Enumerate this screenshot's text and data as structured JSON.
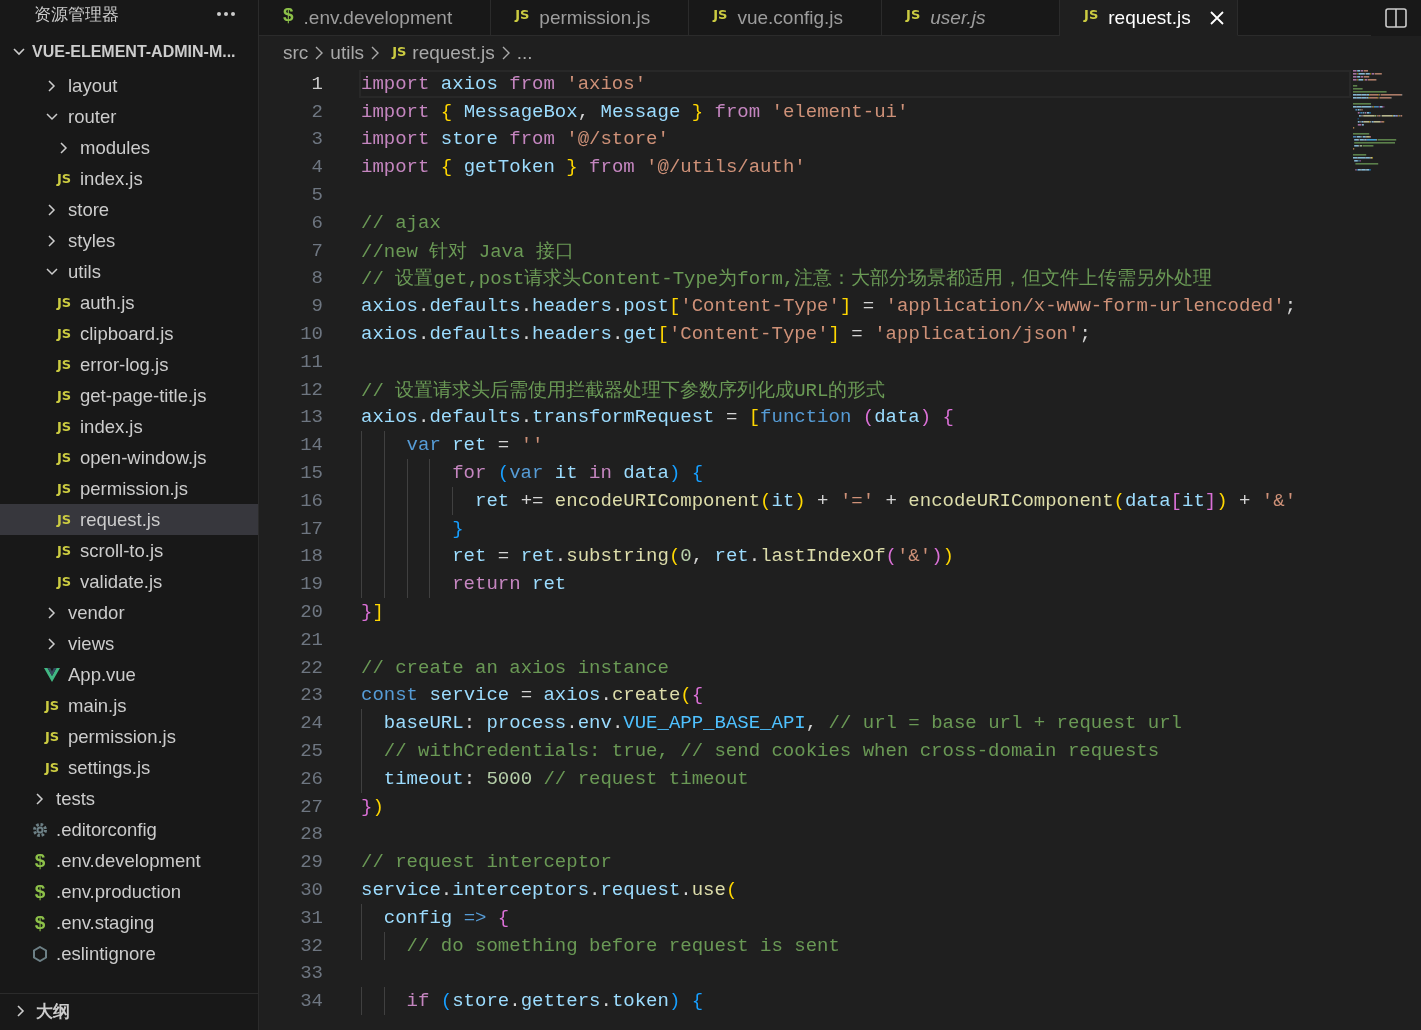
{
  "explorer": {
    "title": "资源管理器",
    "root": {
      "label": "VUE-ELEMENT-ADMIN-M...",
      "expanded": true,
      "children": [
        {
          "children": [
            {
              "label": "layout",
              "expanded": false
            },
            {
              "label": "router",
              "expanded": true,
              "children": [
                {
                  "label": "modules",
                  "expanded": false
                },
                {
                  "label": "index.js",
                  "icon": {
                    "kind": "js",
                    "text": "JS"
                  },
                  "selected": false
                }
              ]
            },
            {
              "label": "store",
              "expanded": false
            },
            {
              "label": "styles",
              "expanded": false
            },
            {
              "label": "utils",
              "expanded": true,
              "children": [
                {
                  "label": "auth.js",
                  "icon": {
                    "kind": "js",
                    "text": "JS"
                  },
                  "selected": false
                },
                {
                  "label": "clipboard.js",
                  "icon": {
                    "kind": "js",
                    "text": "JS"
                  },
                  "selected": false
                },
                {
                  "label": "error-log.js",
                  "icon": {
                    "kind": "js",
                    "text": "JS"
                  },
                  "selected": false
                },
                {
                  "label": "get-page-title.js",
                  "icon": {
                    "kind": "js",
                    "text": "JS"
                  },
                  "selected": false
                },
                {
                  "label": "index.js",
                  "icon": {
                    "kind": "js",
                    "text": "JS"
                  },
                  "selected": false
                },
                {
                  "label": "open-window.js",
                  "icon": {
                    "kind": "js",
                    "text": "JS"
                  },
                  "selected": false
                },
                {
                  "label": "permission.js",
                  "icon": {
                    "kind": "js",
                    "text": "JS"
                  },
                  "selected": false
                },
                {
                  "label": "request.js",
                  "icon": {
                    "kind": "js",
                    "text": "JS"
                  },
                  "selected": true
                },
                {
                  "label": "scroll-to.js",
                  "icon": {
                    "kind": "js",
                    "text": "JS"
                  },
                  "selected": false
                },
                {
                  "label": "validate.js",
                  "icon": {
                    "kind": "js",
                    "text": "JS"
                  },
                  "selected": false
                }
              ]
            },
            {
              "label": "vendor",
              "expanded": false
            },
            {
              "label": "views",
              "expanded": false
            },
            {
              "label": "App.vue",
              "icon": {
                "kind": "vue"
              },
              "selected": false
            },
            {
              "label": "main.js",
              "icon": {
                "kind": "js",
                "text": "JS"
              },
              "selected": false
            },
            {
              "label": "permission.js",
              "icon": {
                "kind": "js",
                "text": "JS"
              },
              "selected": false
            },
            {
              "label": "settings.js",
              "icon": {
                "kind": "js",
                "text": "JS"
              },
              "selected": false
            }
          ]
        },
        {
          "label": "tests",
          "expanded": false
        },
        {
          "label": ".editorconfig",
          "icon": {
            "kind": "gear"
          },
          "selected": false
        },
        {
          "label": ".env.development",
          "icon": {
            "kind": "env",
            "text": "$"
          },
          "selected": false
        },
        {
          "label": ".env.production",
          "icon": {
            "kind": "env",
            "text": "$"
          },
          "selected": false
        },
        {
          "label": ".env.staging",
          "icon": {
            "kind": "env",
            "text": "$"
          },
          "selected": false
        },
        {
          "label": ".eslintignore",
          "icon": {
            "kind": "eslint"
          },
          "selected": false
        }
      ]
    }
  },
  "outline": {
    "label": "大纲",
    "expanded": false
  },
  "tabs": [
    {
      "label": ".env.development",
      "icon": {
        "kind": "env",
        "text": "$"
      },
      "selected": false,
      "preview": false
    },
    {
      "label": "permission.js",
      "icon": {
        "kind": "js",
        "text": "JS"
      },
      "selected": false,
      "preview": false
    },
    {
      "label": "vue.config.js",
      "icon": {
        "kind": "js",
        "text": "JS"
      },
      "selected": false,
      "preview": false
    },
    {
      "label": "user.js",
      "icon": {
        "kind": "js",
        "text": "JS"
      },
      "selected": false,
      "preview": true
    },
    {
      "label": "request.js",
      "icon": {
        "kind": "js",
        "text": "JS"
      },
      "selected": true,
      "preview": false
    }
  ],
  "breadcrumb": {
    "items": [
      {
        "label": "src"
      },
      {
        "label": "utils"
      },
      {
        "label": "request.js",
        "icon": {
          "kind": "js",
          "text": "JS"
        }
      }
    ],
    "more": "..."
  },
  "code": {
    "lines": [
      {
        "number": "1",
        "current": true,
        "tokens": [
          {
            "kind": "k",
            "text": "import "
          },
          {
            "kind": "v",
            "text": "axios "
          },
          {
            "kind": "k",
            "text": "from "
          },
          {
            "kind": "t",
            "text": "'axios'"
          }
        ]
      },
      {
        "number": "2",
        "current": false,
        "tokens": [
          {
            "kind": "k",
            "text": "import "
          },
          {
            "kind": "b1",
            "text": "{ "
          },
          {
            "kind": "v",
            "text": "MessageBox"
          },
          {
            "kind": "p",
            "text": ", "
          },
          {
            "kind": "v",
            "text": "Message "
          },
          {
            "kind": "b1",
            "text": "} "
          },
          {
            "kind": "k",
            "text": "from "
          },
          {
            "kind": "t",
            "text": "'element-ui'"
          }
        ]
      },
      {
        "number": "3",
        "current": false,
        "tokens": [
          {
            "kind": "k",
            "text": "import "
          },
          {
            "kind": "v",
            "text": "store "
          },
          {
            "kind": "k",
            "text": "from "
          },
          {
            "kind": "t",
            "text": "'@/store'"
          }
        ]
      },
      {
        "number": "4",
        "current": false,
        "tokens": [
          {
            "kind": "k",
            "text": "import "
          },
          {
            "kind": "b1",
            "text": "{ "
          },
          {
            "kind": "v",
            "text": "getToken "
          },
          {
            "kind": "b1",
            "text": "} "
          },
          {
            "kind": "k",
            "text": "from "
          },
          {
            "kind": "t",
            "text": "'@/utils/auth'"
          }
        ]
      },
      {
        "number": "5",
        "current": false
      },
      {
        "number": "6",
        "current": false,
        "tokens": [
          {
            "kind": "c",
            "text": "// ajax"
          }
        ]
      },
      {
        "number": "7",
        "current": false,
        "tokens": [
          {
            "kind": "c",
            "text": "//new 针对 Java 接口"
          }
        ]
      },
      {
        "number": "8",
        "current": false,
        "tokens": [
          {
            "kind": "c",
            "text": "// 设置get,post请求头Content-Type为form,注意：大部分场景都适用，但文件上传需另外处理"
          }
        ]
      },
      {
        "number": "9",
        "current": false,
        "tokens": [
          {
            "kind": "v",
            "text": "axios"
          },
          {
            "kind": "p",
            "text": "."
          },
          {
            "kind": "v",
            "text": "defaults"
          },
          {
            "kind": "p",
            "text": "."
          },
          {
            "kind": "v",
            "text": "headers"
          },
          {
            "kind": "p",
            "text": "."
          },
          {
            "kind": "v",
            "text": "post"
          },
          {
            "kind": "b1",
            "text": "["
          },
          {
            "kind": "t",
            "text": "'Content-Type'"
          },
          {
            "kind": "b1",
            "text": "]"
          },
          {
            "kind": "p",
            "text": " = "
          },
          {
            "kind": "t",
            "text": "'application/x-www-form-urlencoded'"
          },
          {
            "kind": "p",
            "text": ";"
          }
        ]
      },
      {
        "number": "10",
        "current": false,
        "tokens": [
          {
            "kind": "v",
            "text": "axios"
          },
          {
            "kind": "p",
            "text": "."
          },
          {
            "kind": "v",
            "text": "defaults"
          },
          {
            "kind": "p",
            "text": "."
          },
          {
            "kind": "v",
            "text": "headers"
          },
          {
            "kind": "p",
            "text": "."
          },
          {
            "kind": "v",
            "text": "get"
          },
          {
            "kind": "b1",
            "text": "["
          },
          {
            "kind": "t",
            "text": "'Content-Type'"
          },
          {
            "kind": "b1",
            "text": "]"
          },
          {
            "kind": "p",
            "text": " = "
          },
          {
            "kind": "t",
            "text": "'application/json'"
          },
          {
            "kind": "p",
            "text": ";"
          }
        ]
      },
      {
        "number": "11",
        "current": false
      },
      {
        "number": "12",
        "current": false,
        "tokens": [
          {
            "kind": "c",
            "text": "// 设置请求头后需使用拦截器处理下参数序列化成URL的形式"
          }
        ]
      },
      {
        "number": "13",
        "current": false,
        "tokens": [
          {
            "kind": "v",
            "text": "axios"
          },
          {
            "kind": "p",
            "text": "."
          },
          {
            "kind": "v",
            "text": "defaults"
          },
          {
            "kind": "p",
            "text": "."
          },
          {
            "kind": "v",
            "text": "transformRequest"
          },
          {
            "kind": "p",
            "text": " = "
          },
          {
            "kind": "b1",
            "text": "["
          },
          {
            "kind": "s",
            "text": "function "
          },
          {
            "kind": "b2",
            "text": "("
          },
          {
            "kind": "v",
            "text": "data"
          },
          {
            "kind": "b2",
            "text": ") "
          },
          {
            "kind": "b2",
            "text": "{"
          }
        ]
      },
      {
        "number": "14",
        "current": false,
        "tokens": [
          {
            "kind": "s",
            "text": "    var "
          },
          {
            "kind": "v",
            "text": "ret "
          },
          {
            "kind": "p",
            "text": "= "
          },
          {
            "kind": "t",
            "text": "''"
          }
        ]
      },
      {
        "number": "15",
        "current": false,
        "tokens": [
          {
            "kind": "k",
            "text": "        for "
          },
          {
            "kind": "b3",
            "text": "("
          },
          {
            "kind": "s",
            "text": "var "
          },
          {
            "kind": "v",
            "text": "it "
          },
          {
            "kind": "k",
            "text": "in "
          },
          {
            "kind": "v",
            "text": "data"
          },
          {
            "kind": "b3",
            "text": ") "
          },
          {
            "kind": "b3",
            "text": "{"
          }
        ]
      },
      {
        "number": "16",
        "current": false,
        "tokens": [
          {
            "kind": "v",
            "text": "          ret "
          },
          {
            "kind": "p",
            "text": "+= "
          },
          {
            "kind": "f",
            "text": "encodeURIComponent"
          },
          {
            "kind": "b1",
            "text": "("
          },
          {
            "kind": "v",
            "text": "it"
          },
          {
            "kind": "b1",
            "text": ")"
          },
          {
            "kind": "p",
            "text": " + "
          },
          {
            "kind": "t",
            "text": "'='"
          },
          {
            "kind": "p",
            "text": " + "
          },
          {
            "kind": "f",
            "text": "encodeURIComponent"
          },
          {
            "kind": "b1",
            "text": "("
          },
          {
            "kind": "v",
            "text": "data"
          },
          {
            "kind": "b2",
            "text": "["
          },
          {
            "kind": "v",
            "text": "it"
          },
          {
            "kind": "b2",
            "text": "]"
          },
          {
            "kind": "b1",
            "text": ")"
          },
          {
            "kind": "p",
            "text": " + "
          },
          {
            "kind": "t",
            "text": "'&'"
          }
        ]
      },
      {
        "number": "17",
        "current": false,
        "tokens": [
          {
            "kind": "b3",
            "text": "        }"
          }
        ]
      },
      {
        "number": "18",
        "current": false,
        "tokens": [
          {
            "kind": "v",
            "text": "        ret "
          },
          {
            "kind": "p",
            "text": "= "
          },
          {
            "kind": "v",
            "text": "ret"
          },
          {
            "kind": "p",
            "text": "."
          },
          {
            "kind": "f",
            "text": "substring"
          },
          {
            "kind": "b1",
            "text": "("
          },
          {
            "kind": "n",
            "text": "0"
          },
          {
            "kind": "p",
            "text": ", "
          },
          {
            "kind": "v",
            "text": "ret"
          },
          {
            "kind": "p",
            "text": "."
          },
          {
            "kind": "f",
            "text": "lastIndexOf"
          },
          {
            "kind": "b2",
            "text": "("
          },
          {
            "kind": "t",
            "text": "'&'"
          },
          {
            "kind": "b2",
            "text": ")"
          },
          {
            "kind": "b1",
            "text": ")"
          }
        ]
      },
      {
        "number": "19",
        "current": false,
        "tokens": [
          {
            "kind": "k",
            "text": "        return "
          },
          {
            "kind": "v",
            "text": "ret"
          }
        ]
      },
      {
        "number": "20",
        "current": false,
        "tokens": [
          {
            "kind": "b2",
            "text": "}"
          },
          {
            "kind": "b1",
            "text": "]"
          }
        ]
      },
      {
        "number": "21",
        "current": false
      },
      {
        "number": "22",
        "current": false,
        "tokens": [
          {
            "kind": "c",
            "text": "// create an axios instance"
          }
        ]
      },
      {
        "number": "23",
        "current": false,
        "tokens": [
          {
            "kind": "s",
            "text": "const "
          },
          {
            "kind": "v",
            "text": "service "
          },
          {
            "kind": "p",
            "text": "= "
          },
          {
            "kind": "v",
            "text": "axios"
          },
          {
            "kind": "p",
            "text": "."
          },
          {
            "kind": "f",
            "text": "create"
          },
          {
            "kind": "b1",
            "text": "("
          },
          {
            "kind": "b2",
            "text": "{"
          }
        ]
      },
      {
        "number": "24",
        "current": false,
        "tokens": [
          {
            "kind": "v",
            "text": "  baseURL"
          },
          {
            "kind": "p",
            "text": ": "
          },
          {
            "kind": "v",
            "text": "process"
          },
          {
            "kind": "p",
            "text": "."
          },
          {
            "kind": "v",
            "text": "env"
          },
          {
            "kind": "p",
            "text": "."
          },
          {
            "kind": "o",
            "text": "VUE_APP_BASE_API"
          },
          {
            "kind": "p",
            "text": ", "
          },
          {
            "kind": "c",
            "text": "// url = base url + request url"
          }
        ]
      },
      {
        "number": "25",
        "current": false,
        "tokens": [
          {
            "kind": "c",
            "text": "  // withCredentials: true, // send cookies when cross-domain requests"
          }
        ]
      },
      {
        "number": "26",
        "current": false,
        "tokens": [
          {
            "kind": "v",
            "text": "  timeout"
          },
          {
            "kind": "p",
            "text": ": "
          },
          {
            "kind": "n",
            "text": "5000 "
          },
          {
            "kind": "c",
            "text": "// request timeout"
          }
        ]
      },
      {
        "number": "27",
        "current": false,
        "tokens": [
          {
            "kind": "b2",
            "text": "}"
          },
          {
            "kind": "b1",
            "text": ")"
          }
        ]
      },
      {
        "number": "28",
        "current": false
      },
      {
        "number": "29",
        "current": false,
        "tokens": [
          {
            "kind": "c",
            "text": "// request interceptor"
          }
        ]
      },
      {
        "number": "30",
        "current": false,
        "tokens": [
          {
            "kind": "v",
            "text": "service"
          },
          {
            "kind": "p",
            "text": "."
          },
          {
            "kind": "v",
            "text": "interceptors"
          },
          {
            "kind": "p",
            "text": "."
          },
          {
            "kind": "v",
            "text": "request"
          },
          {
            "kind": "p",
            "text": "."
          },
          {
            "kind": "f",
            "text": "use"
          },
          {
            "kind": "b1",
            "text": "("
          }
        ]
      },
      {
        "number": "31",
        "current": false,
        "tokens": [
          {
            "kind": "v",
            "text": "  config "
          },
          {
            "kind": "s",
            "text": "=> "
          },
          {
            "kind": "b2",
            "text": "{"
          }
        ]
      },
      {
        "number": "32",
        "current": false,
        "tokens": [
          {
            "kind": "c",
            "text": "    // do something before request is sent"
          }
        ]
      },
      {
        "number": "33",
        "current": false
      },
      {
        "number": "34",
        "current": false,
        "tokens": [
          {
            "kind": "k",
            "text": "    if "
          },
          {
            "kind": "b3",
            "text": "("
          },
          {
            "kind": "v",
            "text": "store"
          },
          {
            "kind": "p",
            "text": "."
          },
          {
            "kind": "v",
            "text": "getters"
          },
          {
            "kind": "p",
            "text": "."
          },
          {
            "kind": "v",
            "text": "token"
          },
          {
            "kind": "b3",
            "text": ") "
          },
          {
            "kind": "b3",
            "text": "{"
          }
        ]
      }
    ]
  }
}
